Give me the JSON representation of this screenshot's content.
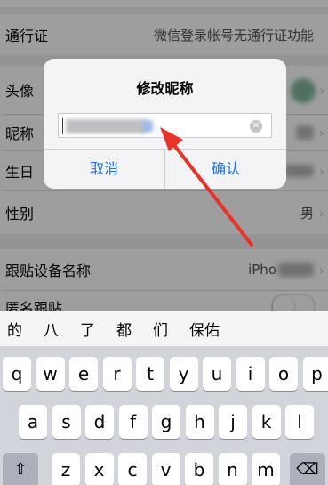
{
  "settings": {
    "pass_label": "通行证",
    "pass_value": "微信登录帐号无通行证功能",
    "avatar_label": "头像",
    "nickname_label": "昵称",
    "birthday_label": "生日",
    "gender_label": "性别",
    "gender_value": "男",
    "device_label": "跟贴设备名称",
    "device_value": "iPho",
    "anon_label": "匿名跟贴",
    "chevron": "›"
  },
  "dialog": {
    "title": "修改昵称",
    "cancel_label": "取消",
    "confirm_label": "确认",
    "clear_glyph": "✕"
  },
  "candidates": [
    "的",
    "八",
    "了",
    "都",
    "们",
    "保佑"
  ],
  "keyboard": {
    "row1": [
      "q",
      "w",
      "e",
      "r",
      "t",
      "y",
      "u",
      "i",
      "o",
      "p"
    ],
    "row2": [
      "a",
      "s",
      "d",
      "f",
      "g",
      "h",
      "j",
      "k",
      "l"
    ],
    "row3": [
      "z",
      "x",
      "c",
      "v",
      "b",
      "n",
      "m"
    ],
    "shift_glyph": "⇧",
    "delete_glyph": "⌫"
  },
  "colors": {
    "accent": "#1a72e8",
    "arrow": "#e8332a"
  }
}
